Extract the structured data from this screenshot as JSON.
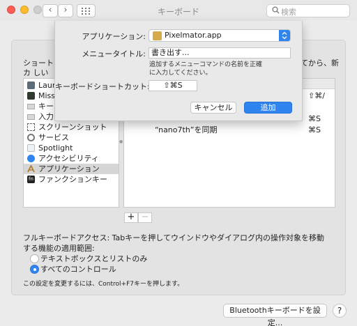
{
  "window": {
    "title": "キーボード"
  },
  "search": {
    "placeholder": "検索"
  },
  "description": {
    "left": "ショートカ しいキーを",
    "right": "てから、新"
  },
  "categories": [
    {
      "label": "Launch",
      "icon": "launchpad-icon"
    },
    {
      "label": "Missi",
      "icon": "mission-control-icon"
    },
    {
      "label": "キーボ",
      "icon": "keyboard-icon"
    },
    {
      "label": "入力ソ",
      "icon": "input-source-icon"
    },
    {
      "label": "スクリーンショット",
      "icon": "screenshot-icon"
    },
    {
      "label": "サービス",
      "icon": "gear-icon"
    },
    {
      "label": "Spotlight",
      "icon": "spotlight-icon"
    },
    {
      "label": "アクセシビリティ",
      "icon": "accessibility-icon"
    },
    {
      "label": "アプリケーション",
      "icon": "app-shortcuts-icon",
      "selected": true
    },
    {
      "label": "ファンクションキー",
      "icon": "fn-key-icon"
    }
  ],
  "shortcuts": [
    {
      "label": "",
      "shortcut": "⇧⌘/"
    },
    {
      "label": "",
      "shortcut": "⌘S"
    },
    {
      "label": "“nano7th”を同期",
      "shortcut": "⌘S"
    }
  ],
  "list_buttons": {
    "add": "+",
    "remove": "−"
  },
  "full_keyboard_access": {
    "text": "フルキーボードアクセス: Tabキーを押してウインドウやダイアログ内の操作対象を移動する機能の適用範囲:",
    "options": [
      {
        "label": "テキストボックスとリストのみ",
        "selected": false
      },
      {
        "label": "すべてのコントロール",
        "selected": true
      }
    ],
    "note": "この設定を変更するには、Control+F7キーを押します。"
  },
  "bluetooth_button": "Bluetoothキーボードを設定...",
  "help_button": "?",
  "sheet": {
    "app_label": "アプリケーション:",
    "app_value": "Pixelmator.app",
    "menu_title_label": "メニュータイトル:",
    "menu_title_value": "書き出す...",
    "hint": "追加するメニューコマンドの名前を正確に入力してください。",
    "shortcut_label": "キーボードショートカット:",
    "shortcut_value": "⇧⌘S",
    "cancel": "キャンセル",
    "add": "追加"
  }
}
